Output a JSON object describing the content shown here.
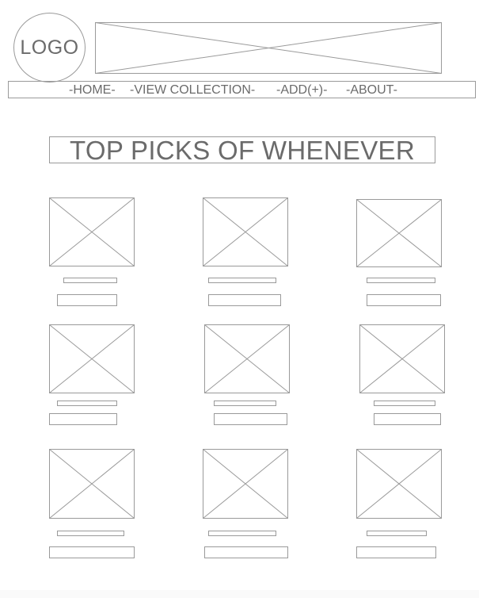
{
  "logo": {
    "text": "LOGO"
  },
  "banner": {
    "icon": "image-placeholder-icon"
  },
  "nav": {
    "home": "-HOME-",
    "view_collection": "-VIEW COLLECTION-",
    "add": "-ADD(+)-",
    "about": "-ABOUT-"
  },
  "page_title": "TOP PICKS OF WHENEVER",
  "colors": {
    "stroke": "#9a9a9a",
    "text": "#6b6b6b",
    "background": "#ffffff"
  },
  "grid": {
    "rows": 3,
    "columns": 3,
    "card_icon": "image-placeholder-icon"
  }
}
